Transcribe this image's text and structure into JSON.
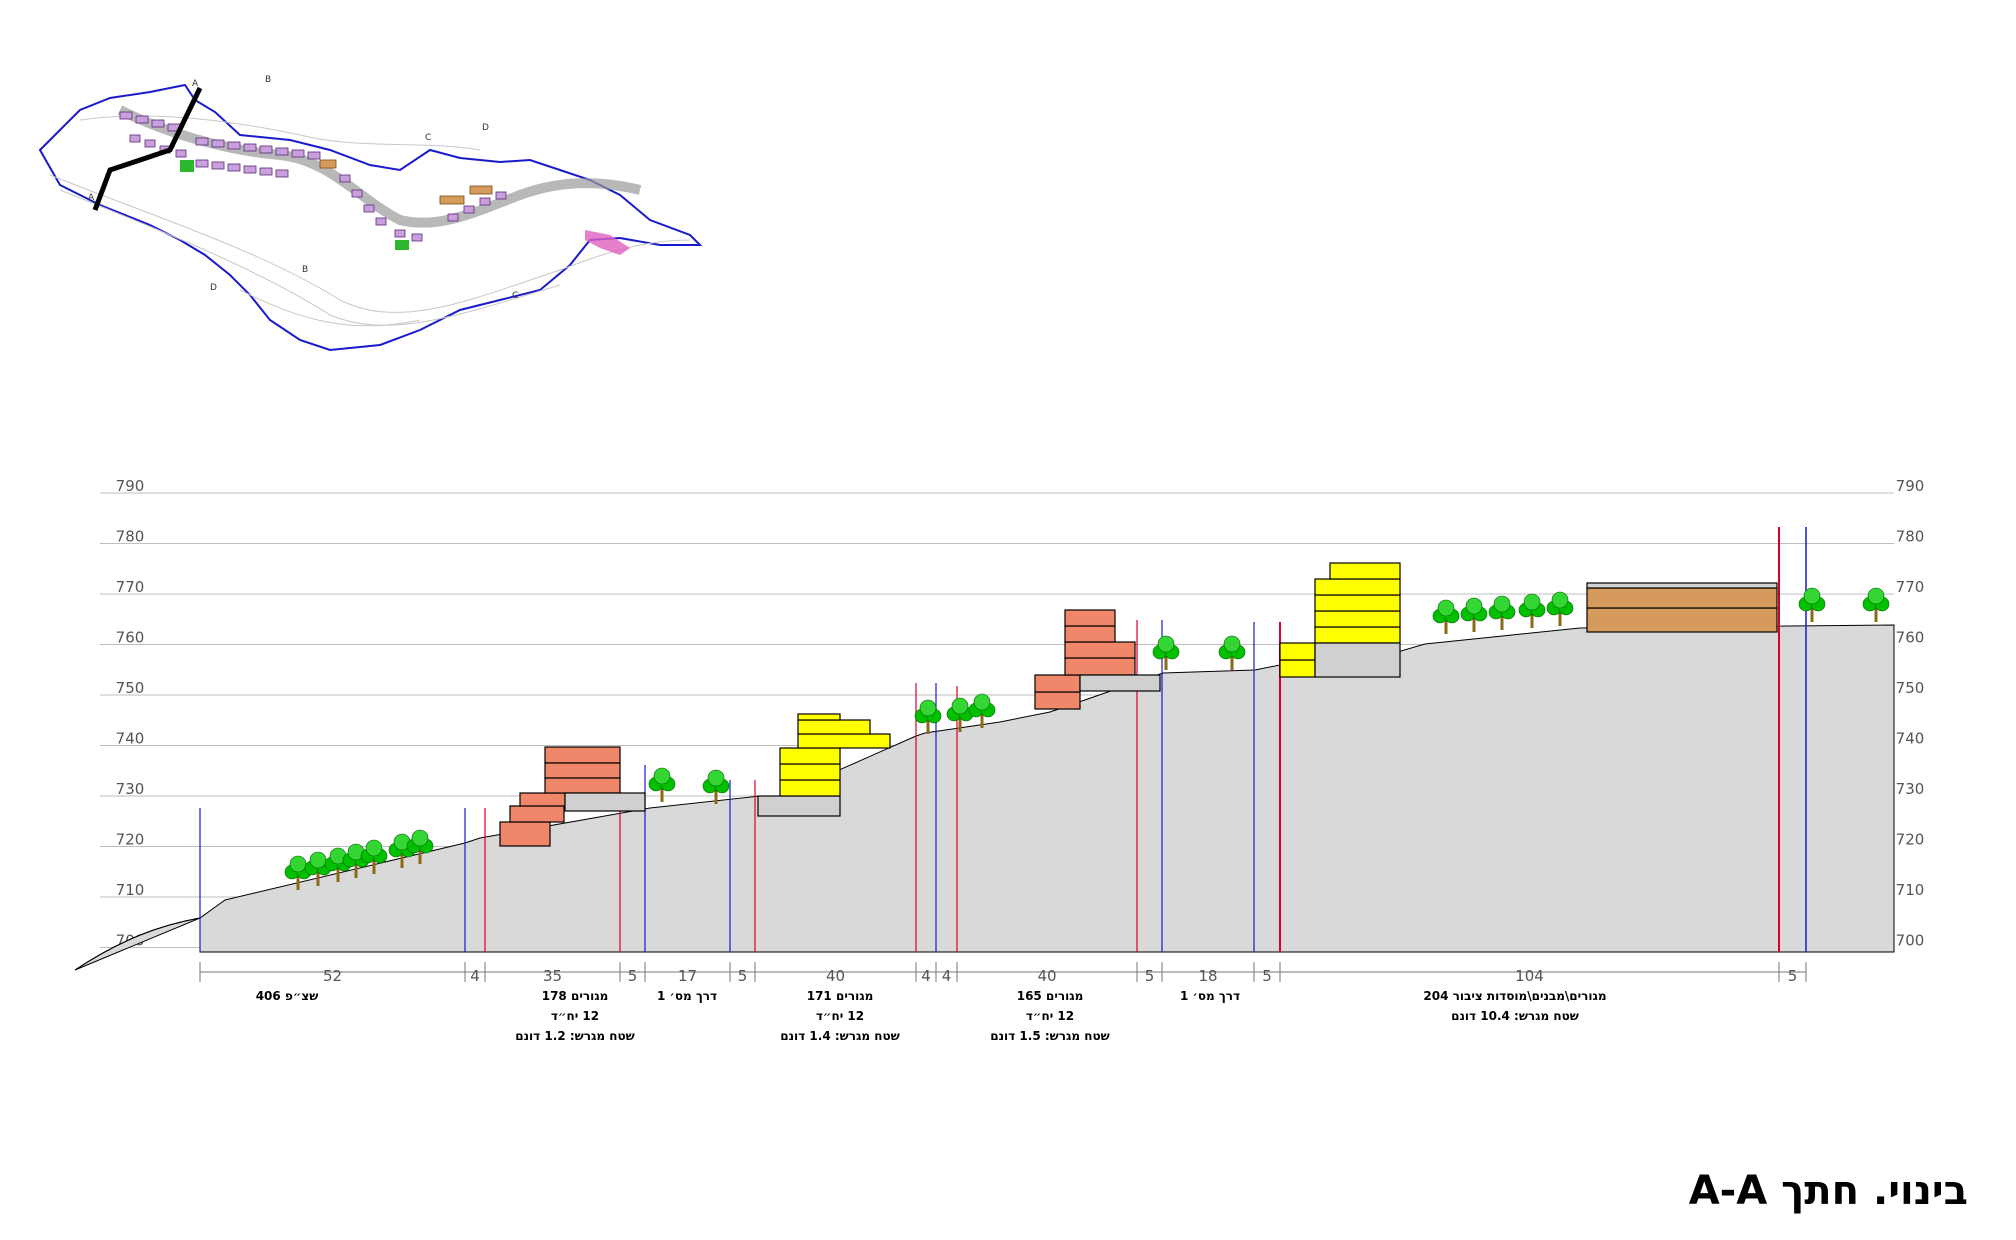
{
  "title": "בינוי. חתך A-A",
  "elevations": [
    "790",
    "780",
    "770",
    "760",
    "750",
    "740",
    "730",
    "720",
    "710",
    "700"
  ],
  "segments": [
    {
      "w": "52"
    },
    {
      "w": "4"
    },
    {
      "w": "35"
    },
    {
      "w": "5"
    },
    {
      "w": "17"
    },
    {
      "w": "5"
    },
    {
      "w": "40"
    },
    {
      "w": "4"
    },
    {
      "w": "4"
    },
    {
      "w": "40"
    },
    {
      "w": "5"
    },
    {
      "w": "18"
    },
    {
      "w": "5"
    },
    {
      "w": "104"
    },
    {
      "w": "5"
    }
  ],
  "labels": [
    {
      "lines": [
        "שצ״פ 406"
      ]
    },
    {
      "lines": [
        "מגורים 178",
        "12 יח״ד",
        "שטח מגרש: 1.2 דונם"
      ]
    },
    {
      "lines": [
        "דרך מס׳ 1"
      ]
    },
    {
      "lines": [
        "מגורים 171",
        "12 יח״ד",
        "שטח מגרש: 1.4 דונם"
      ]
    },
    {
      "lines": [
        "מגורים 165",
        "12 יח״ד",
        "שטח מגרש: 1.5 דונם"
      ]
    },
    {
      "lines": [
        "דרך מס׳ 1"
      ]
    },
    {
      "lines": [
        "מגורים\\מבנים\\מוסדות ציבור 204",
        "שטח מגרש: 10.4 דונם"
      ]
    }
  ],
  "map_letters": [
    "A",
    "A",
    "B",
    "B",
    "C",
    "C",
    "D",
    "D"
  ],
  "colors": {
    "ground": "#d9d9d9",
    "residential": "#f0876b",
    "residential_yellow": "#ffff00",
    "public": "#d69a5c",
    "plan_outline": "#1a1acc",
    "section_line": "#000000",
    "red_line": "#d9002b",
    "blue_line": "#1a1acc",
    "tree": "#00c000"
  }
}
